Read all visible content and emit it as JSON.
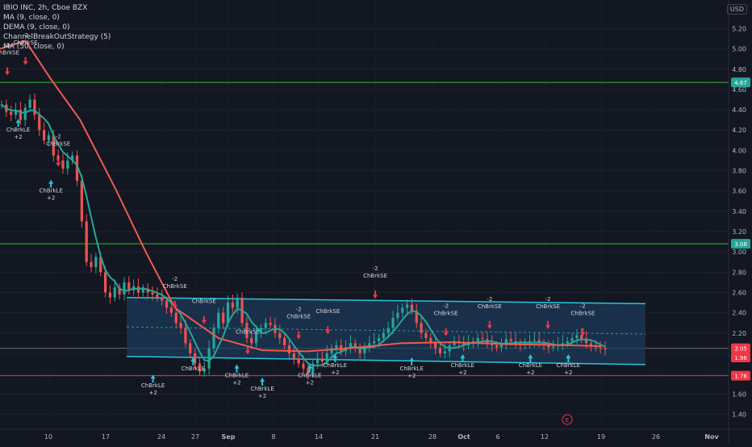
{
  "header": {
    "title": "IBIO INC, 2h, Cboe BZX",
    "currency": "USD",
    "indicators": [
      "MA (9, close, 0)",
      "DEMA (9, close, 0)",
      "ChannelBreakOutStrategy (5)",
      "MA (50, close, 0)"
    ]
  },
  "chart_data": {
    "type": "candlestick",
    "ylim": [
      1.3,
      5.45
    ],
    "y_ticks": [
      "5.20",
      "5.00",
      "4.80",
      "4.60",
      "4.40",
      "4.20",
      "4.00",
      "3.80",
      "3.60",
      "3.40",
      "3.20",
      "3.00",
      "2.80",
      "2.60",
      "2.40",
      "2.20",
      "2.00",
      "1.80",
      "1.60",
      "1.40"
    ],
    "x_ticks": [
      "10",
      "17",
      "24",
      "27",
      "Sep",
      "8",
      "14",
      "21",
      "28",
      "Oct",
      "6",
      "12",
      "19",
      "26",
      "Nov"
    ],
    "price_badges": [
      {
        "value": "4.67",
        "color": "#26a69a"
      },
      {
        "value": "3.08",
        "color": "#26a69a"
      },
      {
        "value": "1.78",
        "color": "#f23645"
      },
      {
        "value": "2.05",
        "color": "#f23645"
      },
      {
        "value": "1.96",
        "color": "#f23645"
      }
    ],
    "horizontal_lines": [
      {
        "value": 4.67,
        "color": "#2ebd2e"
      },
      {
        "value": 3.08,
        "color": "#2ebd2e"
      },
      {
        "value": 1.78,
        "color": "#f23645"
      },
      {
        "value": 2.05,
        "color": "#6a6d78"
      }
    ],
    "channel": {
      "upper": [
        [
          0,
          2.55
        ],
        [
          1,
          2.49
        ]
      ],
      "lower": [
        [
          0,
          1.97
        ],
        [
          1,
          1.89
        ]
      ],
      "mid": [
        [
          0,
          2.26
        ],
        [
          1,
          2.19
        ]
      ],
      "color": "#26c6da"
    },
    "closes": [
      4.45,
      4.38,
      4.35,
      4.4,
      4.3,
      4.42,
      4.5,
      4.35,
      4.2,
      4.1,
      4.15,
      3.95,
      3.9,
      3.82,
      3.9,
      3.95,
      3.7,
      3.3,
      2.9,
      2.85,
      2.95,
      2.8,
      2.6,
      2.55,
      2.65,
      2.58,
      2.7,
      2.62,
      2.66,
      2.6,
      2.64,
      2.6,
      2.58,
      2.55,
      2.52,
      2.45,
      2.4,
      2.3,
      2.25,
      2.1,
      2.0,
      1.9,
      1.82,
      1.85,
      2.05,
      2.25,
      2.4,
      2.3,
      2.5,
      2.45,
      2.55,
      2.3,
      2.15,
      2.1,
      2.2,
      2.25,
      2.3,
      2.28,
      2.2,
      2.15,
      2.08,
      2.0,
      1.95,
      1.9,
      1.85,
      1.8,
      1.9,
      1.95,
      1.92,
      2.0,
      2.05,
      2.08,
      2.02,
      2.06,
      2.1,
      2.05,
      2.0,
      2.05,
      2.1,
      2.12,
      2.15,
      2.2,
      2.25,
      2.35,
      2.4,
      2.45,
      2.48,
      2.42,
      2.3,
      2.2,
      2.15,
      2.1,
      2.05,
      2.0,
      2.02,
      2.08,
      2.12,
      2.1,
      2.08,
      2.1,
      2.12,
      2.15,
      2.14,
      2.1,
      2.08,
      2.06,
      2.1,
      2.14,
      2.12,
      2.1,
      2.08,
      2.1,
      2.12,
      2.13,
      2.1,
      2.08,
      2.06,
      2.07,
      2.09,
      2.1,
      2.12,
      2.15,
      2.18,
      2.14,
      2.1,
      2.08,
      2.06,
      2.05,
      2.04
    ],
    "ma50": [
      [
        0,
        5.0
      ],
      [
        0.035,
        5.08
      ],
      [
        0.07,
        4.7
      ],
      [
        0.11,
        4.3
      ],
      [
        0.16,
        3.6
      ],
      [
        0.2,
        3.0
      ],
      [
        0.24,
        2.45
      ],
      [
        0.3,
        2.15
      ],
      [
        0.36,
        2.03
      ],
      [
        0.42,
        2.02
      ],
      [
        0.48,
        2.05
      ],
      [
        0.55,
        2.1
      ],
      [
        0.62,
        2.11
      ],
      [
        0.7,
        2.09
      ],
      [
        0.78,
        2.08
      ],
      [
        0.825,
        2.07
      ]
    ],
    "markers": [
      {
        "text": [
          "-2",
          "ChBrkSE"
        ],
        "color": "#f23645",
        "x": 0.01,
        "y": 4.85
      },
      {
        "text": [
          "-2",
          "ChBrkSE"
        ],
        "color": "#f23645",
        "x": 0.035,
        "y": 4.95
      },
      {
        "text": [
          "ChBrkLE",
          "+2"
        ],
        "color": "#26c6da",
        "x": 0.025,
        "y": 4.2
      },
      {
        "text": [
          "-2",
          "ChBrkSE"
        ],
        "color": "#f23645",
        "x": 0.08,
        "y": 3.95
      },
      {
        "text": [
          "ChBrkLE",
          "+2"
        ],
        "color": "#26c6da",
        "x": 0.07,
        "y": 3.6
      },
      {
        "text": [
          "-2",
          "ChBrkSE"
        ],
        "color": "#f23645",
        "x": 0.24,
        "y": 2.55
      },
      {
        "text": [
          "ChBrkLE",
          "+2"
        ],
        "color": "#26c6da",
        "x": 0.21,
        "y": 1.68
      },
      {
        "text": [
          "ChBrkSE"
        ],
        "color": "#f23645",
        "x": 0.28,
        "y": 2.4
      },
      {
        "text": [
          "ChBrkLE"
        ],
        "color": "#26c6da",
        "x": 0.265,
        "y": 1.85
      },
      {
        "text": [
          "ChBrkLE",
          "+2"
        ],
        "color": "#26c6da",
        "x": 0.325,
        "y": 1.78
      },
      {
        "text": [
          "ChBrkSE"
        ],
        "color": "#f23645",
        "x": 0.34,
        "y": 2.1
      },
      {
        "text": [
          "ChBrkLE",
          "+2"
        ],
        "color": "#26c6da",
        "x": 0.36,
        "y": 1.65
      },
      {
        "text": [
          "-2",
          "ChBrkSE"
        ],
        "color": "#f23645",
        "x": 0.41,
        "y": 2.25
      },
      {
        "text": [
          "ChBrkLE",
          "+2"
        ],
        "color": "#26c6da",
        "x": 0.425,
        "y": 1.78
      },
      {
        "text": [
          "ChBrkSE"
        ],
        "color": "#f23645",
        "x": 0.45,
        "y": 2.3
      },
      {
        "text": [
          "ChBrkLE",
          "+2"
        ],
        "color": "#26c6da",
        "x": 0.46,
        "y": 1.88
      },
      {
        "text": [
          "-2",
          "ChBrkSE"
        ],
        "color": "#f23645",
        "x": 0.515,
        "y": 2.65
      },
      {
        "text": [
          "ChBrkLE",
          "+2"
        ],
        "color": "#26c6da",
        "x": 0.565,
        "y": 1.85
      },
      {
        "text": [
          "-2",
          "ChBrkSE"
        ],
        "color": "#f23645",
        "x": 0.612,
        "y": 2.28
      },
      {
        "text": [
          "ChBrkLE",
          "+2"
        ],
        "color": "#26c6da",
        "x": 0.635,
        "y": 1.88
      },
      {
        "text": [
          "-2",
          "ChBrkSE"
        ],
        "color": "#f23645",
        "x": 0.672,
        "y": 2.35
      },
      {
        "text": [
          "ChBrkLE",
          "+2"
        ],
        "color": "#26c6da",
        "x": 0.728,
        "y": 1.88
      },
      {
        "text": [
          "-2",
          "ChBrkSE"
        ],
        "color": "#f23645",
        "x": 0.752,
        "y": 2.35
      },
      {
        "text": [
          "-2",
          "ChBrkSE"
        ],
        "color": "#f23645",
        "x": 0.8,
        "y": 2.28
      },
      {
        "text": [
          "ChBrkLE",
          "+2"
        ],
        "color": "#26c6da",
        "x": 0.78,
        "y": 1.88
      }
    ],
    "earnings_badge": "E"
  }
}
